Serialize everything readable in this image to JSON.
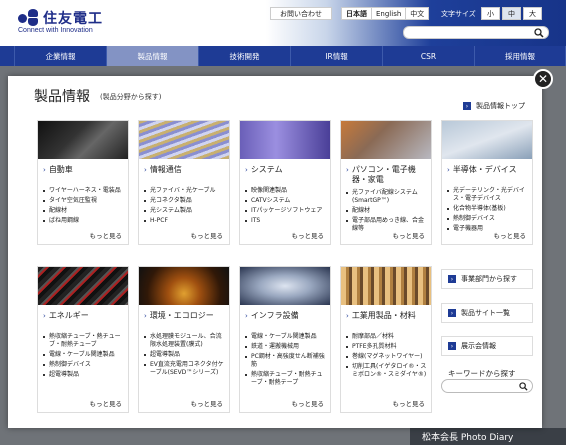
{
  "header": {
    "logo_text": "住友電工",
    "logo_sub": "Connect with Innovation",
    "contact_label": "お問い合わせ",
    "languages": [
      "日本語",
      "English",
      "中文"
    ],
    "font_size_label": "文字サイズ",
    "font_sizes": [
      "小",
      "中",
      "大"
    ],
    "search_placeholder": ""
  },
  "nav": [
    "企業情報",
    "製品情報",
    "技術開発",
    "IR情報",
    "CSR",
    "採用情報"
  ],
  "panel": {
    "title": "製品情報",
    "subtitle": "(製品分野から探す)",
    "top_link": "製品情報トップ",
    "more_label": "もっと見る",
    "cards": [
      {
        "title": "自動車",
        "items": [
          "ワイヤーハーネス・電装品",
          "タイヤ空気圧監視",
          "配線材",
          "ばね用鋼線"
        ]
      },
      {
        "title": "情報通信",
        "items": [
          "光ファイバ・光ケーブル",
          "光コネクタ製品",
          "光システム製品",
          "H-PCF"
        ]
      },
      {
        "title": "システム",
        "items": [
          "映像関連製品",
          "CATVシステム",
          "ITパッケージソフトウェア",
          "ITS"
        ]
      },
      {
        "title": "パソコン・電子機器・家電",
        "items": [
          "光ファイバ配線システム(SmartGP™)",
          "配線材",
          "電子部品用めっき線、合金線等"
        ]
      },
      {
        "title": "半導体・デバイス",
        "items": [
          "光デーテリンク・光デバイス・電子デバイス",
          "化合物半導体(基板)",
          "熱制御デバイス",
          "電子機器用"
        ]
      },
      {
        "title": "エネルギー",
        "items": [
          "熱収縮チューブ・熱チューブ・耐熱チューブ",
          "電線・ケーブル関連製品",
          "熱制御デバイス",
          "超電導製品"
        ]
      },
      {
        "title": "環境・エコロジー",
        "items": [
          "水処理膜モジュール、合流限水処理装置(膜式)",
          "超電導製品",
          "EV直流充電用コネクタ付ケーブル(SEVD™シリーズ)"
        ]
      },
      {
        "title": "インフラ設備",
        "items": [
          "電線・ケーブル関連製品",
          "鉄道・運搬機械用",
          "PC鋼材・高強度せん断補強筋",
          "熱収縮チューブ・耐熱チューブ・耐熱テープ"
        ]
      },
      {
        "title": "工業用製品・材料",
        "items": [
          "耐摩部品／材料",
          "PTFE多孔質材料",
          "巻線(マグネットワイヤー)",
          "切削工具(イゲタロイ®・スミボロン®・スミダイヤ®)"
        ]
      }
    ],
    "side_buttons": [
      "事業部門から探す",
      "製品サイト一覧",
      "展示会情報"
    ],
    "keyword_label": "キーワードから探す",
    "keyword_placeholder": ""
  },
  "footer_text": "松本会長 Photo Diary",
  "colors": {
    "brand": "#1e3b95",
    "nav_active": "#8393c4"
  }
}
